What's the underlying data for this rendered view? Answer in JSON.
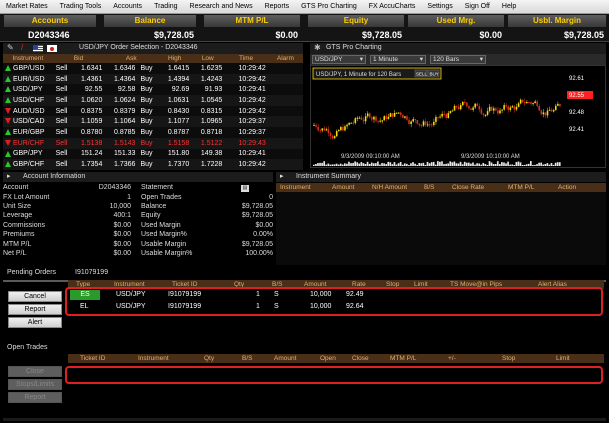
{
  "menu": [
    "Market Rates",
    "Trading Tools",
    "Accounts",
    "Trading",
    "Research and News",
    "Reports",
    "GTS Pro Charting",
    "FX AccuCharts",
    "Settings",
    "Sign Off",
    "Help"
  ],
  "summary": {
    "headers": [
      "Accounts",
      "Balance",
      "MTM P/L",
      "Equity",
      "Used Mrg.",
      "Usbl. Margin"
    ],
    "values": [
      "D2043346",
      "$9,728.05",
      "$0.00",
      "$9,728.05",
      "$0.00",
      "$9,728.05"
    ]
  },
  "quotes": {
    "toolbar_title": "USD/JPY Order Selection - D2043346",
    "columns": [
      "Instrument",
      "Bid",
      "Ask",
      "",
      "High",
      "Low",
      "Time",
      "Alarm"
    ],
    "rows": [
      {
        "sym": "GBP/USD",
        "dir": "up",
        "side": "Sell",
        "bid": "1.6341",
        "ask": "1.6346",
        "act": "Buy",
        "high": "1.6415",
        "low": "1.6235",
        "time": "10:29:42",
        "red": false
      },
      {
        "sym": "EUR/USD",
        "dir": "up",
        "side": "Sell",
        "bid": "1.4361",
        "ask": "1.4364",
        "act": "Buy",
        "high": "1.4394",
        "low": "1.4243",
        "time": "10:29:42",
        "red": false
      },
      {
        "sym": "USD/JPY",
        "dir": "up",
        "side": "Sell",
        "bid": "92.55",
        "ask": "92.58",
        "act": "Buy",
        "high": "92.69",
        "low": "91.93",
        "time": "10:29:41",
        "red": false
      },
      {
        "sym": "USD/CHF",
        "dir": "up",
        "side": "Sell",
        "bid": "1.0620",
        "ask": "1.0624",
        "act": "Buy",
        "high": "1.0631",
        "low": "1.0545",
        "time": "10:29:42",
        "red": false
      },
      {
        "sym": "AUD/USD",
        "dir": "dn",
        "side": "Sell",
        "bid": "0.8375",
        "ask": "0.8379",
        "act": "Buy",
        "high": "0.8430",
        "low": "0.8315",
        "time": "10:29:42",
        "red": false
      },
      {
        "sym": "USD/CAD",
        "dir": "dn",
        "side": "Sell",
        "bid": "1.1059",
        "ask": "1.1064",
        "act": "Buy",
        "high": "1.1077",
        "low": "1.0965",
        "time": "10:29:37",
        "red": false
      },
      {
        "sym": "EUR/GBP",
        "dir": "up",
        "side": "Sell",
        "bid": "0.8780",
        "ask": "0.8785",
        "act": "Buy",
        "high": "0.8787",
        "low": "0.8718",
        "time": "10:29:37",
        "red": false
      },
      {
        "sym": "EUR/CHF",
        "dir": "dn",
        "side": "Sell",
        "bid": "1.5138",
        "ask": "1.5143",
        "act": "Buy",
        "high": "1.5158",
        "low": "1.5122",
        "time": "10:29:43",
        "red": true
      },
      {
        "sym": "GBP/JPY",
        "dir": "up",
        "side": "Sell",
        "bid": "151.24",
        "ask": "151.33",
        "act": "Buy",
        "high": "151.80",
        "low": "149.38",
        "time": "10:29:41",
        "red": false
      },
      {
        "sym": "GBP/CHF",
        "dir": "up",
        "side": "Sell",
        "bid": "1.7354",
        "ask": "1.7366",
        "act": "Buy",
        "high": "1.7370",
        "low": "1.7228",
        "time": "10:29:42",
        "red": false
      }
    ]
  },
  "chart": {
    "panel_title": "GTS Pro Charting",
    "symbol": "USD/JPY",
    "interval": "1 Minute",
    "bars": "120 Bars",
    "legend": "USD/JPY, 1 Minute for 120 Bars",
    "sell_btn": "SELL",
    "buy_btn": "BUY",
    "price_labels": [
      "92.61",
      "92.55",
      "92.48",
      "92.41"
    ],
    "time_labels": [
      "9/3/2009 09:10:00 AM",
      "9/3/2009 10:10:00 AM"
    ],
    "accent_color": "#ffd800",
    "current_price_color": "#ff2020"
  },
  "account": {
    "title": "Account Information",
    "left": [
      {
        "label": "Account",
        "value": "D2043346"
      },
      {
        "label": "FX Lot Amount",
        "value": "1"
      },
      {
        "label": "Unit Size",
        "value": "10,000"
      },
      {
        "label": "Leverage",
        "value": "400:1"
      },
      {
        "label": "Commissions",
        "value": "$0.00"
      },
      {
        "label": "Premiums",
        "value": "$0.00"
      },
      {
        "label": "MTM P/L",
        "value": "$0.00"
      },
      {
        "label": "Net P/L",
        "value": "$0.00"
      }
    ],
    "right": [
      {
        "label": "Statement",
        "value": ""
      },
      {
        "label": "Open Trades",
        "value": "0"
      },
      {
        "label": "Balance",
        "value": "$9,728.05"
      },
      {
        "label": "Equity",
        "value": "$9,728.05"
      },
      {
        "label": "Used Margin",
        "value": "$0.00"
      },
      {
        "label": "Used Margin%",
        "value": "0.00%"
      },
      {
        "label": "Usable Margin",
        "value": "$9,728.05"
      },
      {
        "label": "Usable Margin%",
        "value": "100.00%"
      }
    ]
  },
  "instrument_summary": {
    "title": "Instrument Summary",
    "columns": [
      "Instrument",
      "Amount",
      "N/H Amount",
      "B/S",
      "Close Rate",
      "MTM P/L",
      "Action"
    ]
  },
  "pending": {
    "title": "Pending Orders",
    "account_id": "I91079199",
    "columns": [
      "Type",
      "Instrument",
      "Ticket ID",
      "Qty",
      "B/S",
      "Amount",
      "Rate",
      "Stop",
      "Limit",
      "TS Move@in Pips",
      "Alert Alias"
    ],
    "buttons": [
      "Cancel",
      "Report",
      "Alert"
    ],
    "rows": [
      {
        "type": "ES",
        "instrument": "USD/JPY",
        "ticket": "I91079199",
        "qty": "1",
        "bs": "S",
        "amount": "10,000",
        "rate": "92.49"
      },
      {
        "type": "EL",
        "instrument": "USD/JPY",
        "ticket": "I91079199",
        "qty": "1",
        "bs": "S",
        "amount": "10,000",
        "rate": "92.64"
      }
    ]
  },
  "open_trades": {
    "title": "Open Trades",
    "columns": [
      "Ticket ID",
      "Instrument",
      "Qty",
      "B/S",
      "Amount",
      "Open",
      "Close",
      "MTM P/L",
      "+/-",
      "Stop",
      "Limit"
    ],
    "buttons": [
      "Close",
      "Stops/Limits",
      "Report"
    ]
  }
}
